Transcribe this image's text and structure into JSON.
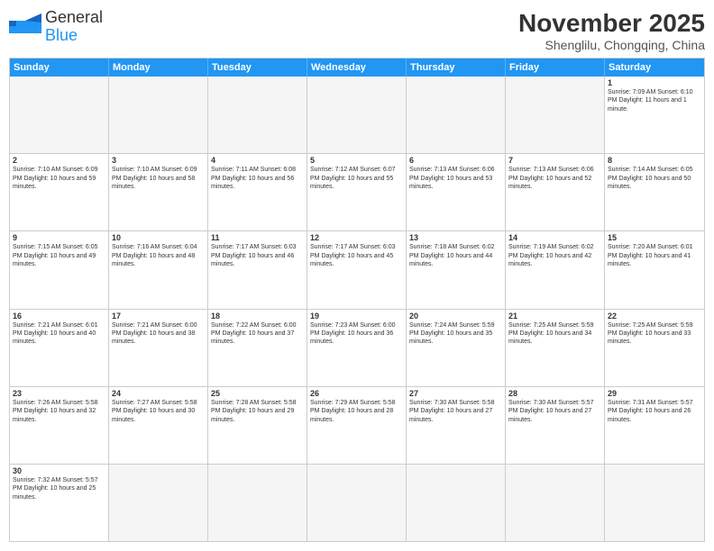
{
  "logo": {
    "text_general": "General",
    "text_blue": "Blue"
  },
  "title": "November 2025",
  "location": "Shenglilu, Chongqing, China",
  "day_headers": [
    "Sunday",
    "Monday",
    "Tuesday",
    "Wednesday",
    "Thursday",
    "Friday",
    "Saturday"
  ],
  "weeks": [
    {
      "days": [
        {
          "num": "",
          "info": "",
          "empty": true
        },
        {
          "num": "",
          "info": "",
          "empty": true
        },
        {
          "num": "",
          "info": "",
          "empty": true
        },
        {
          "num": "",
          "info": "",
          "empty": true
        },
        {
          "num": "",
          "info": "",
          "empty": true
        },
        {
          "num": "",
          "info": "",
          "empty": true
        },
        {
          "num": "1",
          "info": "Sunrise: 7:09 AM\nSunset: 6:10 PM\nDaylight: 11 hours and 1 minute.",
          "empty": false
        }
      ]
    },
    {
      "days": [
        {
          "num": "2",
          "info": "Sunrise: 7:10 AM\nSunset: 6:09 PM\nDaylight: 10 hours and 59 minutes.",
          "empty": false
        },
        {
          "num": "3",
          "info": "Sunrise: 7:10 AM\nSunset: 6:09 PM\nDaylight: 10 hours and 58 minutes.",
          "empty": false
        },
        {
          "num": "4",
          "info": "Sunrise: 7:11 AM\nSunset: 6:08 PM\nDaylight: 10 hours and 56 minutes.",
          "empty": false
        },
        {
          "num": "5",
          "info": "Sunrise: 7:12 AM\nSunset: 6:07 PM\nDaylight: 10 hours and 55 minutes.",
          "empty": false
        },
        {
          "num": "6",
          "info": "Sunrise: 7:13 AM\nSunset: 6:06 PM\nDaylight: 10 hours and 53 minutes.",
          "empty": false
        },
        {
          "num": "7",
          "info": "Sunrise: 7:13 AM\nSunset: 6:06 PM\nDaylight: 10 hours and 52 minutes.",
          "empty": false
        },
        {
          "num": "8",
          "info": "Sunrise: 7:14 AM\nSunset: 6:05 PM\nDaylight: 10 hours and 50 minutes.",
          "empty": false
        }
      ]
    },
    {
      "days": [
        {
          "num": "9",
          "info": "Sunrise: 7:15 AM\nSunset: 6:05 PM\nDaylight: 10 hours and 49 minutes.",
          "empty": false
        },
        {
          "num": "10",
          "info": "Sunrise: 7:16 AM\nSunset: 6:04 PM\nDaylight: 10 hours and 48 minutes.",
          "empty": false
        },
        {
          "num": "11",
          "info": "Sunrise: 7:17 AM\nSunset: 6:03 PM\nDaylight: 10 hours and 46 minutes.",
          "empty": false
        },
        {
          "num": "12",
          "info": "Sunrise: 7:17 AM\nSunset: 6:03 PM\nDaylight: 10 hours and 45 minutes.",
          "empty": false
        },
        {
          "num": "13",
          "info": "Sunrise: 7:18 AM\nSunset: 6:02 PM\nDaylight: 10 hours and 44 minutes.",
          "empty": false
        },
        {
          "num": "14",
          "info": "Sunrise: 7:19 AM\nSunset: 6:02 PM\nDaylight: 10 hours and 42 minutes.",
          "empty": false
        },
        {
          "num": "15",
          "info": "Sunrise: 7:20 AM\nSunset: 6:01 PM\nDaylight: 10 hours and 41 minutes.",
          "empty": false
        }
      ]
    },
    {
      "days": [
        {
          "num": "16",
          "info": "Sunrise: 7:21 AM\nSunset: 6:01 PM\nDaylight: 10 hours and 40 minutes.",
          "empty": false
        },
        {
          "num": "17",
          "info": "Sunrise: 7:21 AM\nSunset: 6:00 PM\nDaylight: 10 hours and 38 minutes.",
          "empty": false
        },
        {
          "num": "18",
          "info": "Sunrise: 7:22 AM\nSunset: 6:00 PM\nDaylight: 10 hours and 37 minutes.",
          "empty": false
        },
        {
          "num": "19",
          "info": "Sunrise: 7:23 AM\nSunset: 6:00 PM\nDaylight: 10 hours and 36 minutes.",
          "empty": false
        },
        {
          "num": "20",
          "info": "Sunrise: 7:24 AM\nSunset: 5:59 PM\nDaylight: 10 hours and 35 minutes.",
          "empty": false
        },
        {
          "num": "21",
          "info": "Sunrise: 7:25 AM\nSunset: 5:59 PM\nDaylight: 10 hours and 34 minutes.",
          "empty": false
        },
        {
          "num": "22",
          "info": "Sunrise: 7:25 AM\nSunset: 5:59 PM\nDaylight: 10 hours and 33 minutes.",
          "empty": false
        }
      ]
    },
    {
      "days": [
        {
          "num": "23",
          "info": "Sunrise: 7:26 AM\nSunset: 5:58 PM\nDaylight: 10 hours and 32 minutes.",
          "empty": false
        },
        {
          "num": "24",
          "info": "Sunrise: 7:27 AM\nSunset: 5:58 PM\nDaylight: 10 hours and 30 minutes.",
          "empty": false
        },
        {
          "num": "25",
          "info": "Sunrise: 7:28 AM\nSunset: 5:58 PM\nDaylight: 10 hours and 29 minutes.",
          "empty": false
        },
        {
          "num": "26",
          "info": "Sunrise: 7:29 AM\nSunset: 5:58 PM\nDaylight: 10 hours and 28 minutes.",
          "empty": false
        },
        {
          "num": "27",
          "info": "Sunrise: 7:30 AM\nSunset: 5:58 PM\nDaylight: 10 hours and 27 minutes.",
          "empty": false
        },
        {
          "num": "28",
          "info": "Sunrise: 7:30 AM\nSunset: 5:57 PM\nDaylight: 10 hours and 27 minutes.",
          "empty": false
        },
        {
          "num": "29",
          "info": "Sunrise: 7:31 AM\nSunset: 5:57 PM\nDaylight: 10 hours and 26 minutes.",
          "empty": false
        }
      ]
    },
    {
      "days": [
        {
          "num": "30",
          "info": "Sunrise: 7:32 AM\nSunset: 5:57 PM\nDaylight: 10 hours and 25 minutes.",
          "empty": false
        },
        {
          "num": "",
          "info": "",
          "empty": true
        },
        {
          "num": "",
          "info": "",
          "empty": true
        },
        {
          "num": "",
          "info": "",
          "empty": true
        },
        {
          "num": "",
          "info": "",
          "empty": true
        },
        {
          "num": "",
          "info": "",
          "empty": true
        },
        {
          "num": "",
          "info": "",
          "empty": true
        }
      ]
    }
  ]
}
